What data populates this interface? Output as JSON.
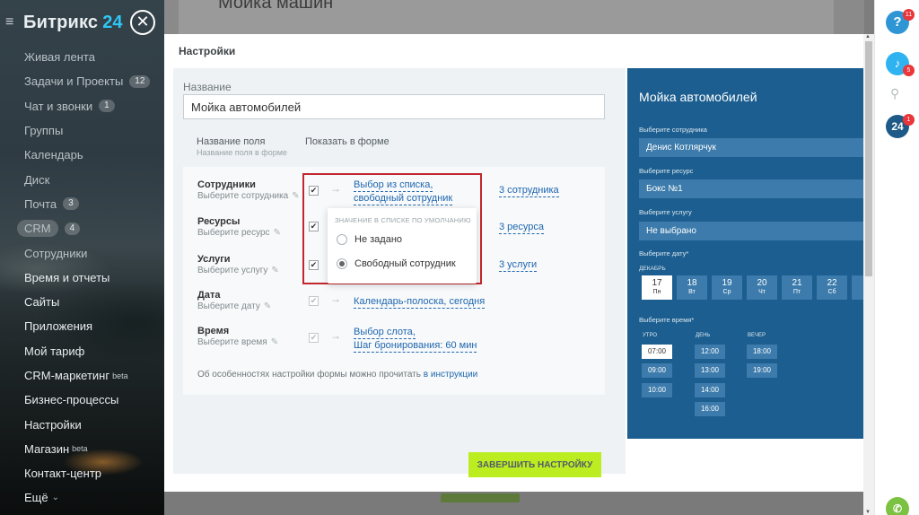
{
  "sidebar": {
    "logo_text": "Битрикс",
    "logo_num": "24",
    "items": [
      {
        "label": "Живая лента",
        "count": ""
      },
      {
        "label": "Задачи и Проекты",
        "count": "12"
      },
      {
        "label": "Чат и звонки",
        "count": "1"
      },
      {
        "label": "Группы",
        "count": ""
      },
      {
        "label": "Календарь",
        "count": ""
      },
      {
        "label": "Диск",
        "count": ""
      },
      {
        "label": "Почта",
        "count": "3"
      },
      {
        "label": "CRM",
        "count": "4"
      },
      {
        "label": "Сотрудники",
        "count": ""
      },
      {
        "label": "Время и отчеты",
        "count": ""
      },
      {
        "label": "Сайты",
        "count": ""
      },
      {
        "label": "Приложения",
        "count": ""
      },
      {
        "label": "Мой тариф",
        "count": ""
      },
      {
        "label": "CRM-маркетинг",
        "sup": "beta"
      },
      {
        "label": "Бизнес-процессы",
        "count": ""
      },
      {
        "label": "Настройки",
        "count": ""
      },
      {
        "label": "Магазин",
        "sup": "beta"
      },
      {
        "label": "Контакт-центр",
        "count": ""
      },
      {
        "label": "Ещё",
        "count": ""
      }
    ]
  },
  "background_page": {
    "title": "Мойка машин"
  },
  "panel": {
    "title": "Настройки",
    "name_label": "Название",
    "name_value": "Мойка автомобилей",
    "col_field": "Название поля",
    "col_field_sub": "Название поля в форме",
    "col_show": "Показать в форме",
    "fields": [
      {
        "name": "Сотрудники",
        "sub": "Выберите сотрудника",
        "link1": "Выбор из списка,",
        "link2": "свободный сотрудник",
        "count": "3 сотрудника"
      },
      {
        "name": "Ресурсы",
        "sub": "Выберите ресурс",
        "count": "3 ресурса"
      },
      {
        "name": "Услуги",
        "sub": "Выберите услугу",
        "count": "3 услуги"
      },
      {
        "name": "Дата",
        "sub": "Выберите дату",
        "link1": "Календарь-полоска, сегодня"
      },
      {
        "name": "Время",
        "sub": "Выберите время",
        "link1": "Выбор слота,",
        "link2": "Шаг бронирования: 60 мин"
      }
    ],
    "footnote": "Об особенностях настройки формы можно прочитать в",
    "footnote_link": "в инструкции",
    "popup": {
      "title": "ЗНАЧЕНИЕ В СПИСКЕ ПО УМОЛЧАНИЮ",
      "option1": "Не задано",
      "option2": "Свободный сотрудник"
    },
    "finish_button": "ЗАВЕРШИТЬ НАСТРОЙКУ"
  },
  "preview": {
    "title": "Мойка автомобилей",
    "employee_label": "Выберите сотрудника",
    "employee_value": "Денис Котлярчук",
    "resource_label": "Выберите ресурс",
    "resource_value": "Бокс №1",
    "service_label": "Выберите услугу",
    "service_value": "Не выбрано",
    "date_label": "Выберите дату*",
    "month": "ДЕКАБРЬ",
    "days": [
      {
        "d": "17",
        "w": "Пн"
      },
      {
        "d": "18",
        "w": "Вт"
      },
      {
        "d": "19",
        "w": "Ср"
      },
      {
        "d": "20",
        "w": "Чт"
      },
      {
        "d": "21",
        "w": "Пт"
      },
      {
        "d": "22",
        "w": "Сб"
      }
    ],
    "time_label": "Выберите время*",
    "morning": "УТРО",
    "day": "ДЕНЬ",
    "evening": "ВЕЧЕР",
    "morning_slots": [
      "07:00",
      "09:00",
      "10:00"
    ],
    "day_slots": [
      "12:00",
      "13:00",
      "14:00",
      "16:00"
    ],
    "evening_slots": [
      "18:00",
      "19:00"
    ]
  },
  "right_rail": {
    "help_badge": "11",
    "notif_badge": "5",
    "b24_label": "24",
    "b24_badge": "1"
  },
  "colors": {
    "accent": "#2fc6f6",
    "preview_bg": "#1c5e8f",
    "finish_btn": "#bbed21",
    "link": "#2067b0",
    "highlight": "#c1272d"
  }
}
